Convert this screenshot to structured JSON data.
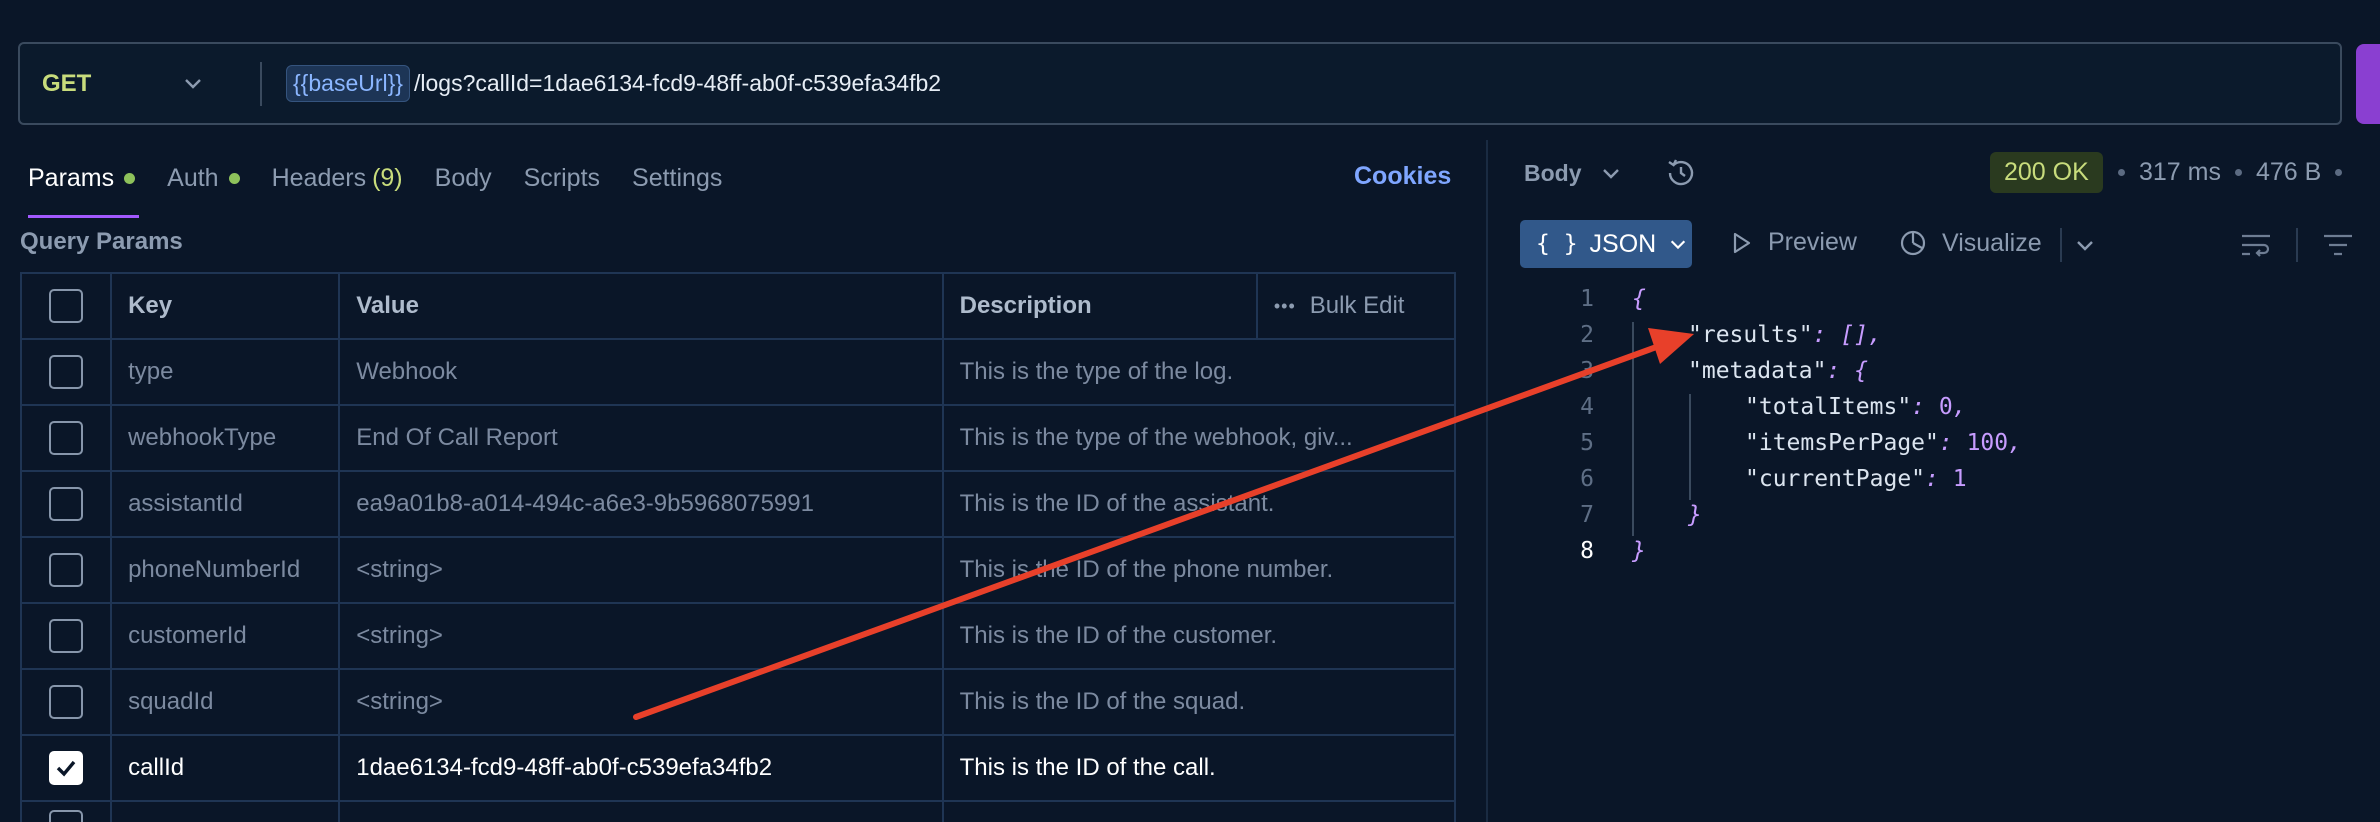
{
  "request": {
    "method": "GET",
    "url_variable": "{{baseUrl}}",
    "url_path": "/logs?callId=1dae6134-fcd9-48ff-ab0f-c539efa34fb2"
  },
  "tabs": {
    "params": "Params",
    "auth": "Auth",
    "headers": "Headers",
    "headers_count": "(9)",
    "body": "Body",
    "scripts": "Scripts",
    "settings": "Settings",
    "cookies": "Cookies"
  },
  "query_params": {
    "title": "Query Params",
    "columns": {
      "key": "Key",
      "value": "Value",
      "description": "Description",
      "bulk_edit": "Bulk Edit"
    },
    "rows": [
      {
        "key": "type",
        "value": "Webhook",
        "description": "This is the type of the log.",
        "checked": false
      },
      {
        "key": "webhookType",
        "value": "End Of Call Report",
        "description": "This is the type of the webhook, giv...",
        "checked": false
      },
      {
        "key": "assistantId",
        "value": "ea9a01b8-a014-494c-a6e3-9b5968075991",
        "description": "This is the ID of the assistant.",
        "checked": false
      },
      {
        "key": "phoneNumberId",
        "value": "<string>",
        "description": "This is the ID of the phone number.",
        "checked": false
      },
      {
        "key": "customerId",
        "value": "<string>",
        "description": "This is the ID of the customer.",
        "checked": false
      },
      {
        "key": "squadId",
        "value": "<string>",
        "description": "This is the ID of the squad.",
        "checked": false
      },
      {
        "key": "callId",
        "value": "1dae6134-fcd9-48ff-ab0f-c539efa34fb2",
        "description": "This is the ID of the call.",
        "checked": true
      }
    ]
  },
  "response": {
    "body_label": "Body",
    "status": "200 OK",
    "time": "317 ms",
    "size": "476 B",
    "format": "JSON",
    "preview": "Preview",
    "visualize": "Visualize",
    "code_lines": [
      {
        "n": "1",
        "indent": 0,
        "key": "",
        "value": "{"
      },
      {
        "n": "2",
        "indent": 1,
        "key": "\"results\"",
        "value": ": [],"
      },
      {
        "n": "3",
        "indent": 1,
        "key": "\"metadata\"",
        "value": ": {"
      },
      {
        "n": "4",
        "indent": 2,
        "key": "\"totalItems\"",
        "value": ": 0,"
      },
      {
        "n": "5",
        "indent": 2,
        "key": "\"itemsPerPage\"",
        "value": ": 100,"
      },
      {
        "n": "6",
        "indent": 2,
        "key": "\"currentPage\"",
        "value": ": 1"
      },
      {
        "n": "7",
        "indent": 1,
        "key": "",
        "value": "}"
      },
      {
        "n": "8",
        "indent": 0,
        "key": "",
        "value": "}"
      }
    ]
  },
  "colors": {
    "background": "#0a1628",
    "accent_purple": "#a259ff",
    "method_green": "#c8dc7c",
    "link_blue": "#7fa6ff",
    "annotation_red": "#e8402a"
  }
}
